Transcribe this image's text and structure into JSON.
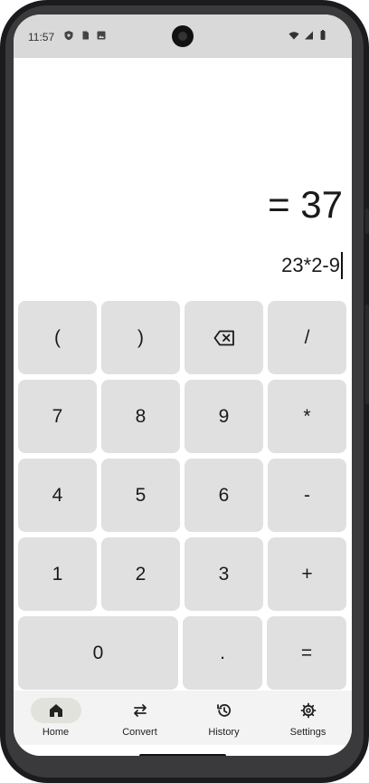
{
  "status_bar": {
    "time": "11:57"
  },
  "display": {
    "result": "= 37",
    "expression": "23*2-9"
  },
  "keypad": {
    "row1": [
      "(",
      ")",
      "",
      "/"
    ],
    "row2": [
      "7",
      "8",
      "9",
      "*"
    ],
    "row3": [
      "4",
      "5",
      "6",
      "-"
    ],
    "row4": [
      "1",
      "2",
      "3",
      "+"
    ],
    "row5": [
      "0",
      ".",
      "="
    ],
    "backspace_icon": "backspace-icon"
  },
  "nav": {
    "items": [
      {
        "label": "Home",
        "icon": "home-icon",
        "active": true
      },
      {
        "label": "Convert",
        "icon": "swap-arrows-icon",
        "active": false
      },
      {
        "label": "History",
        "icon": "history-icon",
        "active": false
      },
      {
        "label": "Settings",
        "icon": "gear-icon",
        "active": false
      }
    ]
  },
  "colors": {
    "key": "#e0e0e0",
    "active_nav_pill": "#e2e2dc",
    "nav_bg": "#f3f3f3"
  }
}
